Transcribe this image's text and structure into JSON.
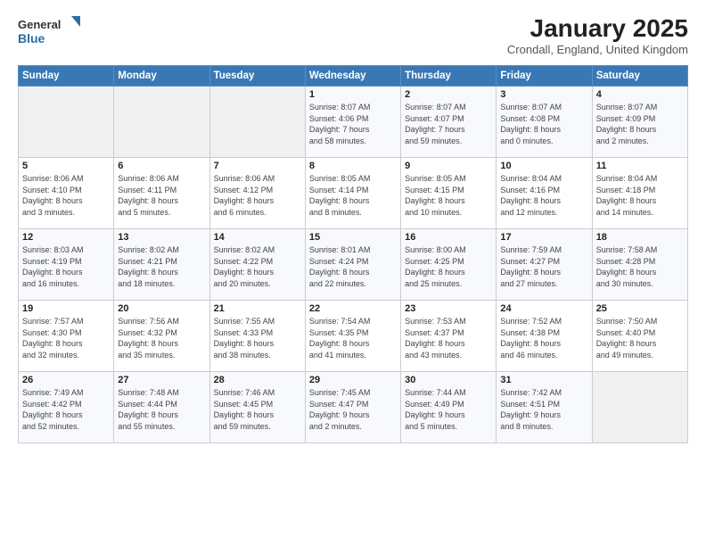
{
  "logo": {
    "line1": "General",
    "line2": "Blue"
  },
  "title": "January 2025",
  "location": "Crondall, England, United Kingdom",
  "headers": [
    "Sunday",
    "Monday",
    "Tuesday",
    "Wednesday",
    "Thursday",
    "Friday",
    "Saturday"
  ],
  "weeks": [
    [
      {
        "day": "",
        "info": ""
      },
      {
        "day": "",
        "info": ""
      },
      {
        "day": "",
        "info": ""
      },
      {
        "day": "1",
        "info": "Sunrise: 8:07 AM\nSunset: 4:06 PM\nDaylight: 7 hours\nand 58 minutes."
      },
      {
        "day": "2",
        "info": "Sunrise: 8:07 AM\nSunset: 4:07 PM\nDaylight: 7 hours\nand 59 minutes."
      },
      {
        "day": "3",
        "info": "Sunrise: 8:07 AM\nSunset: 4:08 PM\nDaylight: 8 hours\nand 0 minutes."
      },
      {
        "day": "4",
        "info": "Sunrise: 8:07 AM\nSunset: 4:09 PM\nDaylight: 8 hours\nand 2 minutes."
      }
    ],
    [
      {
        "day": "5",
        "info": "Sunrise: 8:06 AM\nSunset: 4:10 PM\nDaylight: 8 hours\nand 3 minutes."
      },
      {
        "day": "6",
        "info": "Sunrise: 8:06 AM\nSunset: 4:11 PM\nDaylight: 8 hours\nand 5 minutes."
      },
      {
        "day": "7",
        "info": "Sunrise: 8:06 AM\nSunset: 4:12 PM\nDaylight: 8 hours\nand 6 minutes."
      },
      {
        "day": "8",
        "info": "Sunrise: 8:05 AM\nSunset: 4:14 PM\nDaylight: 8 hours\nand 8 minutes."
      },
      {
        "day": "9",
        "info": "Sunrise: 8:05 AM\nSunset: 4:15 PM\nDaylight: 8 hours\nand 10 minutes."
      },
      {
        "day": "10",
        "info": "Sunrise: 8:04 AM\nSunset: 4:16 PM\nDaylight: 8 hours\nand 12 minutes."
      },
      {
        "day": "11",
        "info": "Sunrise: 8:04 AM\nSunset: 4:18 PM\nDaylight: 8 hours\nand 14 minutes."
      }
    ],
    [
      {
        "day": "12",
        "info": "Sunrise: 8:03 AM\nSunset: 4:19 PM\nDaylight: 8 hours\nand 16 minutes."
      },
      {
        "day": "13",
        "info": "Sunrise: 8:02 AM\nSunset: 4:21 PM\nDaylight: 8 hours\nand 18 minutes."
      },
      {
        "day": "14",
        "info": "Sunrise: 8:02 AM\nSunset: 4:22 PM\nDaylight: 8 hours\nand 20 minutes."
      },
      {
        "day": "15",
        "info": "Sunrise: 8:01 AM\nSunset: 4:24 PM\nDaylight: 8 hours\nand 22 minutes."
      },
      {
        "day": "16",
        "info": "Sunrise: 8:00 AM\nSunset: 4:25 PM\nDaylight: 8 hours\nand 25 minutes."
      },
      {
        "day": "17",
        "info": "Sunrise: 7:59 AM\nSunset: 4:27 PM\nDaylight: 8 hours\nand 27 minutes."
      },
      {
        "day": "18",
        "info": "Sunrise: 7:58 AM\nSunset: 4:28 PM\nDaylight: 8 hours\nand 30 minutes."
      }
    ],
    [
      {
        "day": "19",
        "info": "Sunrise: 7:57 AM\nSunset: 4:30 PM\nDaylight: 8 hours\nand 32 minutes."
      },
      {
        "day": "20",
        "info": "Sunrise: 7:56 AM\nSunset: 4:32 PM\nDaylight: 8 hours\nand 35 minutes."
      },
      {
        "day": "21",
        "info": "Sunrise: 7:55 AM\nSunset: 4:33 PM\nDaylight: 8 hours\nand 38 minutes."
      },
      {
        "day": "22",
        "info": "Sunrise: 7:54 AM\nSunset: 4:35 PM\nDaylight: 8 hours\nand 41 minutes."
      },
      {
        "day": "23",
        "info": "Sunrise: 7:53 AM\nSunset: 4:37 PM\nDaylight: 8 hours\nand 43 minutes."
      },
      {
        "day": "24",
        "info": "Sunrise: 7:52 AM\nSunset: 4:38 PM\nDaylight: 8 hours\nand 46 minutes."
      },
      {
        "day": "25",
        "info": "Sunrise: 7:50 AM\nSunset: 4:40 PM\nDaylight: 8 hours\nand 49 minutes."
      }
    ],
    [
      {
        "day": "26",
        "info": "Sunrise: 7:49 AM\nSunset: 4:42 PM\nDaylight: 8 hours\nand 52 minutes."
      },
      {
        "day": "27",
        "info": "Sunrise: 7:48 AM\nSunset: 4:44 PM\nDaylight: 8 hours\nand 55 minutes."
      },
      {
        "day": "28",
        "info": "Sunrise: 7:46 AM\nSunset: 4:45 PM\nDaylight: 8 hours\nand 59 minutes."
      },
      {
        "day": "29",
        "info": "Sunrise: 7:45 AM\nSunset: 4:47 PM\nDaylight: 9 hours\nand 2 minutes."
      },
      {
        "day": "30",
        "info": "Sunrise: 7:44 AM\nSunset: 4:49 PM\nDaylight: 9 hours\nand 5 minutes."
      },
      {
        "day": "31",
        "info": "Sunrise: 7:42 AM\nSunset: 4:51 PM\nDaylight: 9 hours\nand 8 minutes."
      },
      {
        "day": "",
        "info": ""
      }
    ]
  ]
}
